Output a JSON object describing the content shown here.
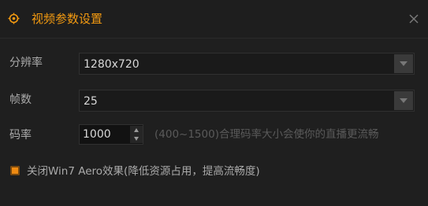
{
  "dialog": {
    "title": "视频参数设置",
    "title_icon": "settings-target-icon",
    "close_icon": "close-icon",
    "accent_color": "#f39a11"
  },
  "resolution": {
    "label": "分辨率",
    "value": "1280x720",
    "arrow_icon": "chevron-down-icon"
  },
  "framerate": {
    "label": "帧数",
    "value": "25",
    "arrow_icon": "chevron-down-icon"
  },
  "bitrate": {
    "label": "码率",
    "value": "1000",
    "hint": "(400~1500)合理码率大小会使你的直播更流畅"
  },
  "aero": {
    "label": "关闭Win7 Aero效果(降低资源占用，提高流畅度)",
    "checked": true
  }
}
